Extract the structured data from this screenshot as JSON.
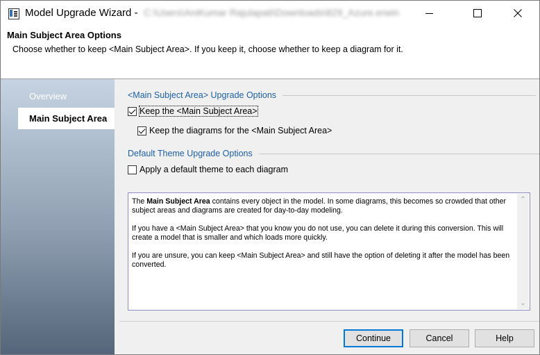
{
  "window": {
    "title": "Model Upgrade Wizard -",
    "path": "C:\\Users\\AniKumar Rajulapati\\Downloads\\829_Azure.erwin"
  },
  "header": {
    "title": "Main Subject Area Options",
    "description": "Choose whether to keep <Main Subject Area>. If you keep it, choose whether to keep a diagram for it."
  },
  "nav": {
    "items": [
      {
        "label": "Overview",
        "active": false
      },
      {
        "label": "Main Subject Area",
        "active": true
      }
    ]
  },
  "groups": {
    "subject_area": {
      "title": "<Main Subject Area> Upgrade Options",
      "keep_label": "Keep the <Main Subject Area>",
      "keep_checked": true,
      "keep_diagrams_label": "Keep the diagrams for the <Main Subject Area>",
      "keep_diagrams_checked": true
    },
    "theme": {
      "title": "Default Theme Upgrade Options",
      "apply_label": "Apply a default theme to each diagram",
      "apply_checked": false
    }
  },
  "info": {
    "p1_prefix": "The",
    "p1_bold": "Main Subject Area",
    "p1_rest": "contains every object in the model. In some diagrams, this becomes so crowded that other subject areas and diagrams are created for day-to-day modeling.",
    "p2": "If you have a <Main Subject Area> that you know you do not use, you can delete it during this conversion. This will create a model that is smaller and which loads more quickly.",
    "p3": "If you are unsure, you can keep <Main Subject Area> and still have the option of deleting it after the model has been converted."
  },
  "buttons": {
    "continue": "Continue",
    "cancel": "Cancel",
    "help": "Help"
  },
  "icons": {
    "minimize": "minimize-icon",
    "maximize": "maximize-icon",
    "close": "close-icon",
    "app": "app-icon"
  }
}
